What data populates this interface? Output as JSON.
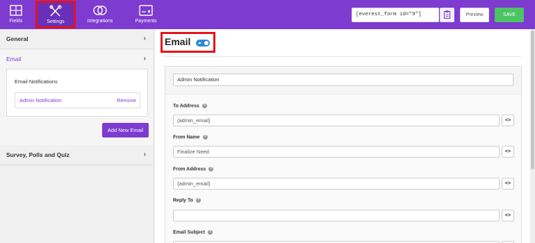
{
  "nav": {
    "fields": {
      "label": "Fields",
      "icon": "fields-icon"
    },
    "settings": {
      "label": "Settings",
      "icon": "settings-tools-icon"
    },
    "integrations": {
      "label": "Integrations",
      "icon": "integrations-icon"
    },
    "payments": {
      "label": "Payments",
      "icon": "payments-icon"
    }
  },
  "toolbar": {
    "shortcode": "[everest_form id=\"9\"]",
    "preview_label": "Preview",
    "save_label": "SAVE"
  },
  "sidebar": {
    "general_label": "General",
    "email_label": "Email",
    "notifications_title": "Email Notifications",
    "notification_name": "Admin Notification",
    "remove_label": "Remove",
    "add_email_label": "Add New Email",
    "survey_label": "Survey, Polls and Quiz"
  },
  "main": {
    "title": "Email",
    "toggle_on": true,
    "notification_name_value": "Admin Notification",
    "fields": [
      {
        "label": "To Address",
        "value": "{admin_email}"
      },
      {
        "label": "From Name",
        "value": "Finalize Need"
      },
      {
        "label": "From Address",
        "value": "{admin_email}"
      },
      {
        "label": "Reply To",
        "value": ""
      },
      {
        "label": "Email Subject",
        "value": ""
      }
    ],
    "code_button_label": "<>"
  },
  "colors": {
    "brand": "#7e3bd0",
    "save": "#4cc463",
    "highlight": "#e5121b",
    "toggle": "#2d8ad8"
  }
}
